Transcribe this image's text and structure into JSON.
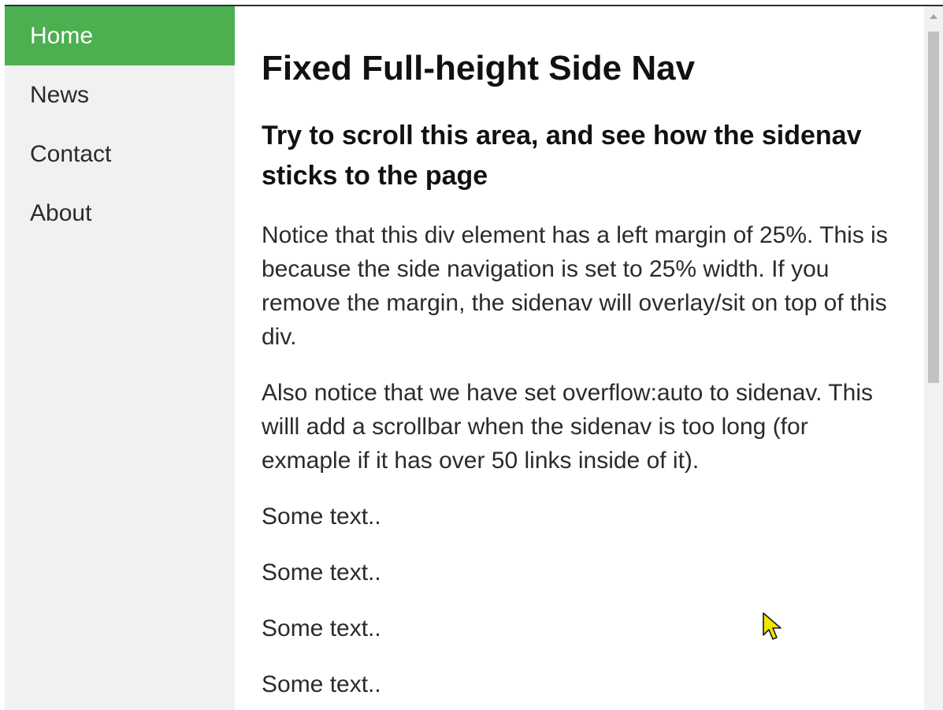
{
  "sidenav": {
    "items": [
      {
        "label": "Home",
        "active": true
      },
      {
        "label": "News",
        "active": false
      },
      {
        "label": "Contact",
        "active": false
      },
      {
        "label": "About",
        "active": false
      }
    ],
    "active_color": "#4caf50",
    "background_color": "#f1f1f1"
  },
  "main": {
    "title": "Fixed Full-height Side Nav",
    "subtitle": "Try to scroll this area, and see how the sidenav sticks to the page",
    "paragraphs": [
      "Notice that this div element has a left margin of 25%. This is because the side navigation is set to 25% width. If you remove the margin, the sidenav will overlay/sit on top of this div.",
      "Also notice that we have set overflow:auto to sidenav. This willl add a scrollbar when the sidenav is too long (for exmaple if it has over 50 links inside of it).",
      "Some text..",
      "Some text..",
      "Some text..",
      "Some text.."
    ]
  },
  "icons": {
    "cursor": "mouse-pointer-icon",
    "scroll_up": "chevron-up-icon"
  }
}
